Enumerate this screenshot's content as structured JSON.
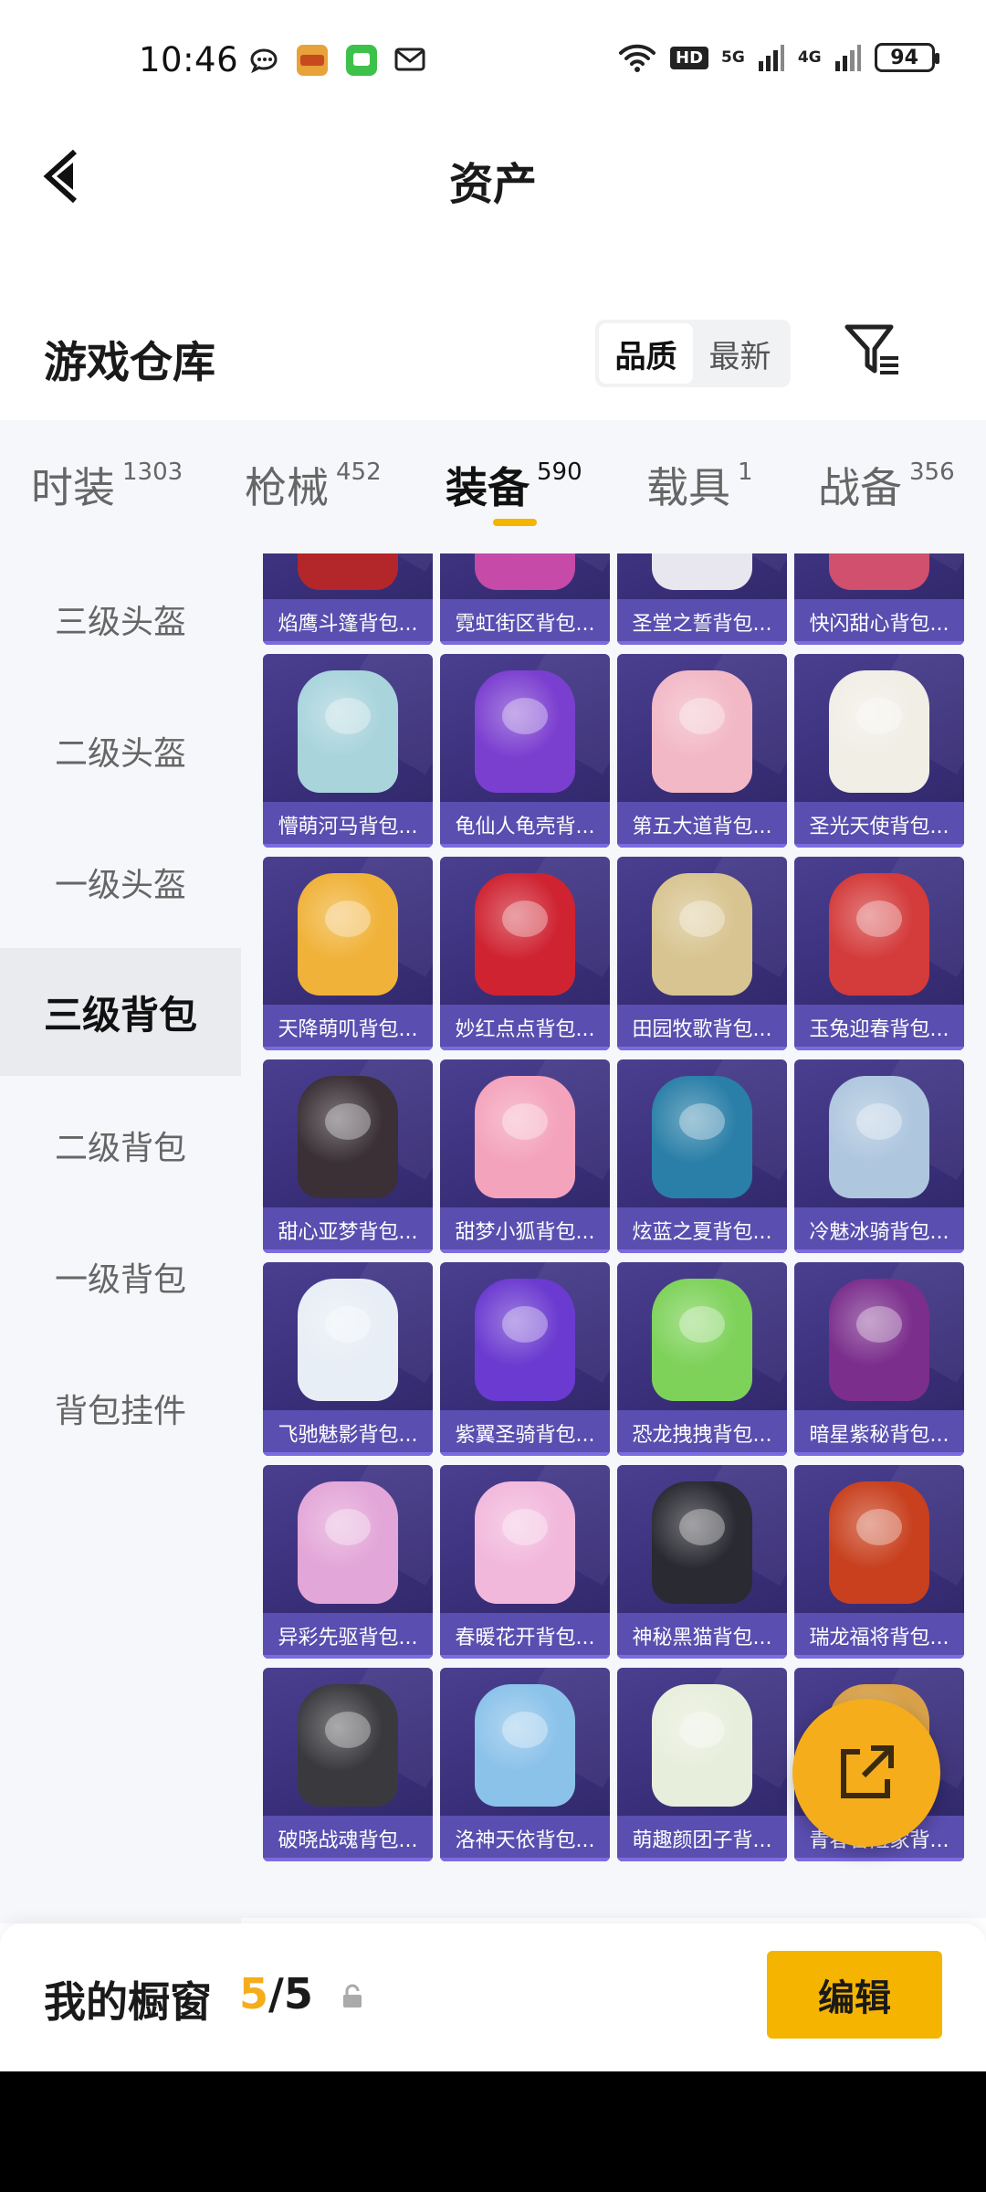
{
  "status_bar": {
    "time": "10:46",
    "battery": "94",
    "network_1": "5G",
    "network_2": "4G",
    "hd": "HD"
  },
  "header": {
    "title": "资产"
  },
  "warehouse": {
    "title": "游戏仓库",
    "sort_options": [
      "品质",
      "最新"
    ],
    "sort_active": "品质"
  },
  "tabs": [
    {
      "label": "时装",
      "count": "1303"
    },
    {
      "label": "枪械",
      "count": "452"
    },
    {
      "label": "装备",
      "count": "590",
      "active": true
    },
    {
      "label": "载具",
      "count": "1"
    },
    {
      "label": "战备",
      "count": "356"
    }
  ],
  "sidebar": {
    "items": [
      "三级头盔",
      "二级头盔",
      "一级头盔",
      "三级背包",
      "二级背包",
      "一级背包",
      "背包挂件"
    ],
    "active": "三级背包"
  },
  "items": [
    {
      "name": "焰鹰斗篷背包...",
      "color": "#b3262a"
    },
    {
      "name": "霓虹街区背包...",
      "color": "#c64aa8"
    },
    {
      "name": "圣堂之誓背包...",
      "color": "#e8e6ee"
    },
    {
      "name": "快闪甜心背包...",
      "color": "#d0506e"
    },
    {
      "name": "懵萌河马背包...",
      "color": "#a9d4dc"
    },
    {
      "name": "龟仙人龟壳背...",
      "color": "#7b3fd0"
    },
    {
      "name": "第五大道背包...",
      "color": "#f2b8c6"
    },
    {
      "name": "圣光天使背包...",
      "color": "#f1eee6"
    },
    {
      "name": "天降萌叽背包...",
      "color": "#f0b238"
    },
    {
      "name": "妙红点点背包...",
      "color": "#cf2331"
    },
    {
      "name": "田园牧歌背包...",
      "color": "#d8c490"
    },
    {
      "name": "玉兔迎春背包...",
      "color": "#d43b3b"
    },
    {
      "name": "甜心亚梦背包...",
      "color": "#3a3036"
    },
    {
      "name": "甜梦小狐背包...",
      "color": "#f4a3bc"
    },
    {
      "name": "炫蓝之夏背包...",
      "color": "#2a7fa8"
    },
    {
      "name": "冷魅冰骑背包...",
      "color": "#aec6de"
    },
    {
      "name": "飞驰魅影背包...",
      "color": "#e8eef6"
    },
    {
      "name": "紫翼圣骑背包...",
      "color": "#6b3ad0"
    },
    {
      "name": "恐龙拽拽背包...",
      "color": "#7ed25a"
    },
    {
      "name": "暗星紫秘背包...",
      "color": "#7b2e8c"
    },
    {
      "name": "异彩先驱背包...",
      "color": "#e3a6d8"
    },
    {
      "name": "春暖花开背包...",
      "color": "#f2b8dc"
    },
    {
      "name": "神秘黑猫背包...",
      "color": "#2a2a32"
    },
    {
      "name": "瑞龙福将背包...",
      "color": "#c8401e"
    },
    {
      "name": "破晓战魂背包...",
      "color": "#3a3a3e"
    },
    {
      "name": "洛神天依背包...",
      "color": "#8bc2ea"
    },
    {
      "name": "萌趣颜团子背...",
      "color": "#e8eedc"
    },
    {
      "name": "青春冒险家背...",
      "color": "#d9a24a"
    }
  ],
  "bottom": {
    "showcase_label": "我的橱窗",
    "showcase_current": "5",
    "showcase_total": "5",
    "edit_label": "编辑"
  }
}
